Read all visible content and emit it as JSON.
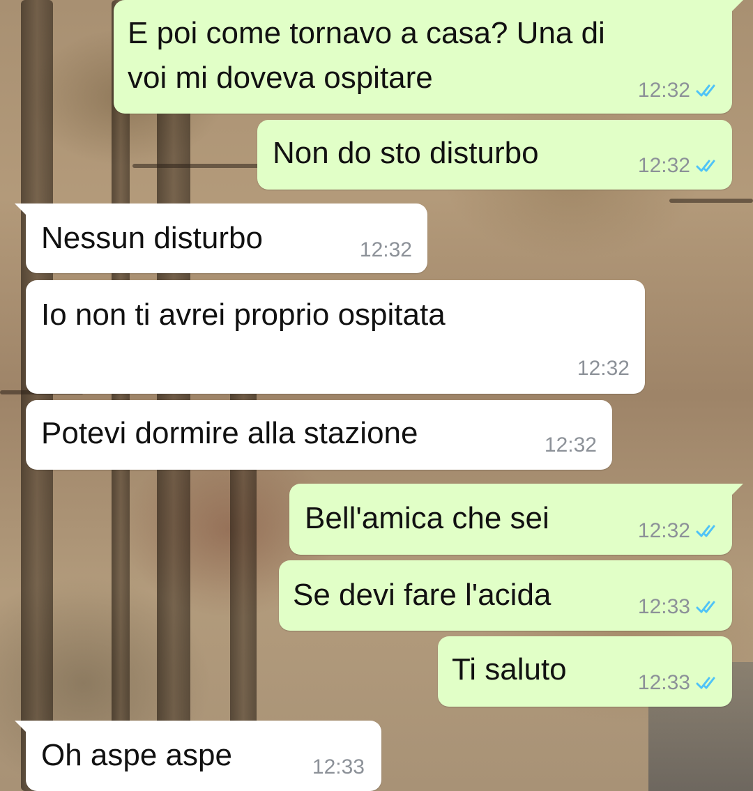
{
  "conversation": {
    "messages": [
      {
        "direction": "out",
        "text_lines": [
          "E poi come tornavo a casa? Una di",
          "voi mi doveva ospitare"
        ],
        "time": "12:32",
        "read_icon": "double-check-icon",
        "read_color": "#4fc3f7"
      },
      {
        "direction": "out",
        "text_lines": [
          "Non do sto disturbo"
        ],
        "time": "12:32",
        "read_icon": "double-check-icon",
        "read_color": "#4fc3f7"
      },
      {
        "direction": "in",
        "text_lines": [
          "Nessun disturbo"
        ],
        "time": "12:32"
      },
      {
        "direction": "in",
        "text_lines": [
          "Io non ti avrei proprio ospitata"
        ],
        "time": "12:32"
      },
      {
        "direction": "in",
        "text_lines": [
          "Potevi dormire alla stazione"
        ],
        "time": "12:32"
      },
      {
        "direction": "out",
        "text_lines": [
          "Bell'amica che sei"
        ],
        "time": "12:32",
        "read_icon": "double-check-icon",
        "read_color": "#4fc3f7"
      },
      {
        "direction": "out",
        "text_lines": [
          "Se devi fare l'acida"
        ],
        "time": "12:33",
        "read_icon": "double-check-icon",
        "read_color": "#4fc3f7"
      },
      {
        "direction": "out",
        "text_lines": [
          "Ti saluto"
        ],
        "time": "12:33",
        "read_icon": "double-check-icon",
        "read_color": "#4fc3f7"
      },
      {
        "direction": "in",
        "text_lines": [
          "Oh aspe aspe"
        ],
        "time": "12:33"
      }
    ]
  },
  "colors": {
    "outgoing_bubble": "#e1ffc7",
    "incoming_bubble": "#ffffff",
    "timestamp": "#8c9198",
    "read_ticks": "#4fc3f7"
  }
}
